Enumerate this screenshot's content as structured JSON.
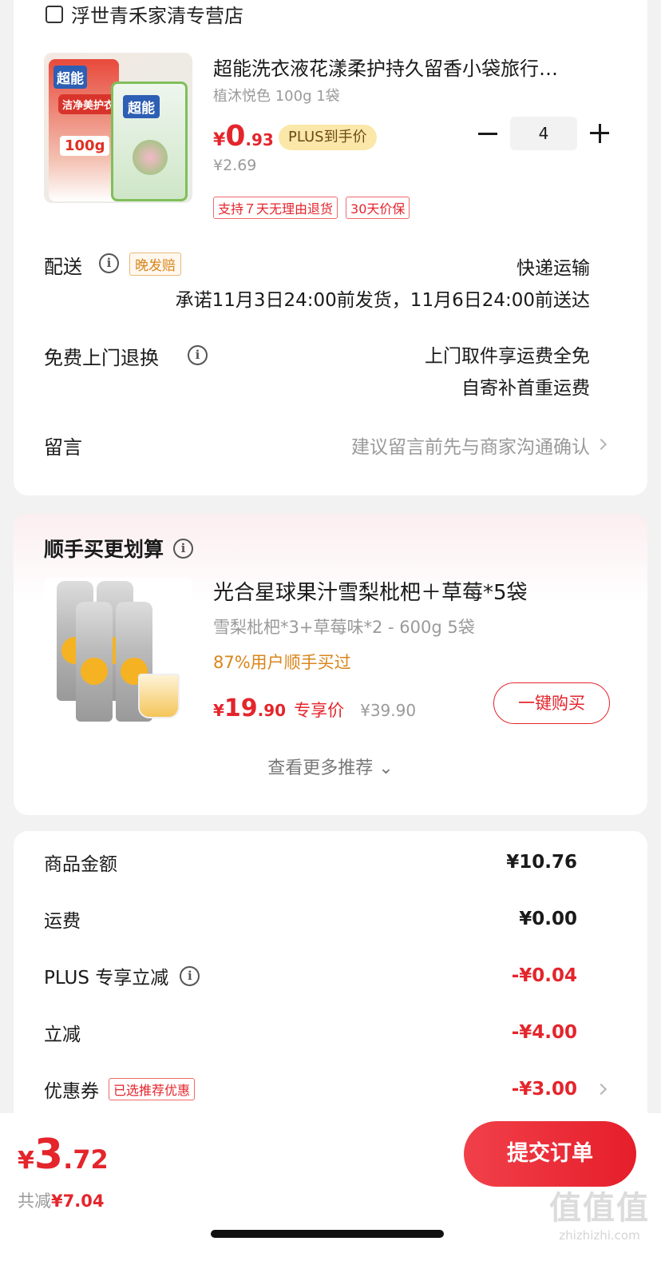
{
  "store": {
    "name": "浮世青禾家清专营店",
    "product": {
      "title": "超能洗衣液花漾柔护持久留香小袋旅行…",
      "spec": "植沐悦色 100g 1袋",
      "price_symbol": "¥",
      "price_int": "0",
      "price_dec": ".93",
      "plus_tag": "PLUS到手价",
      "orig_price": "¥2.69",
      "quantity": "4",
      "tags": [
        "支持７天无理由退货",
        "30天价保"
      ],
      "image_text": {
        "brand": "超能",
        "sub": "洁净美护衣",
        "weight": "100g"
      }
    },
    "delivery": {
      "label": "配送",
      "late_tag": "晚发赔",
      "method": "快递运输",
      "promise": "承诺11月3日24:00前发货，11月6日24:00前送达"
    },
    "free_return": {
      "label": "免费上门退换",
      "line1": "上门取件享运费全免",
      "line2": "自寄补首重运费"
    },
    "message": {
      "label": "留言",
      "placeholder": "建议留言前先与商家沟通确认"
    }
  },
  "recommend": {
    "title": "顺手买更划算",
    "item": {
      "title": "光合星球果汁雪梨枇杷＋草莓*5袋",
      "spec": "雪梨枇杷*3+草莓味*2 - 600g 5袋",
      "bought": "87%用户顺手买过",
      "price_symbol": "¥",
      "price_int": "19",
      "price_dec": ".90",
      "exclusive": "专享价",
      "orig_price": "¥39.90",
      "buy_label": "一键购买"
    },
    "more": "查看更多推荐 ⌄"
  },
  "summary": {
    "rows": [
      {
        "label": "商品金额",
        "value": "¥10.76"
      },
      {
        "label": "运费",
        "value": "¥0.00"
      },
      {
        "label": "PLUS 专享立减",
        "value": "-¥0.04"
      },
      {
        "label": "立减",
        "value": "-¥4.00"
      },
      {
        "label": "优惠券",
        "tag": "已选推荐优惠",
        "value": "-¥3.00"
      }
    ]
  },
  "bottom": {
    "total_symbol": "¥",
    "total_int": "3",
    "total_dec": ".72",
    "saved_label": "共减",
    "saved_value": "¥7.04",
    "submit_label": "提交订单"
  },
  "watermark": {
    "big": "值值值",
    "small": "zhizhizhi.com"
  },
  "colors": {
    "accent": "#e4252c",
    "plus_tag_bg": "#fbe7a8",
    "bought_orange": "#d9851b"
  }
}
